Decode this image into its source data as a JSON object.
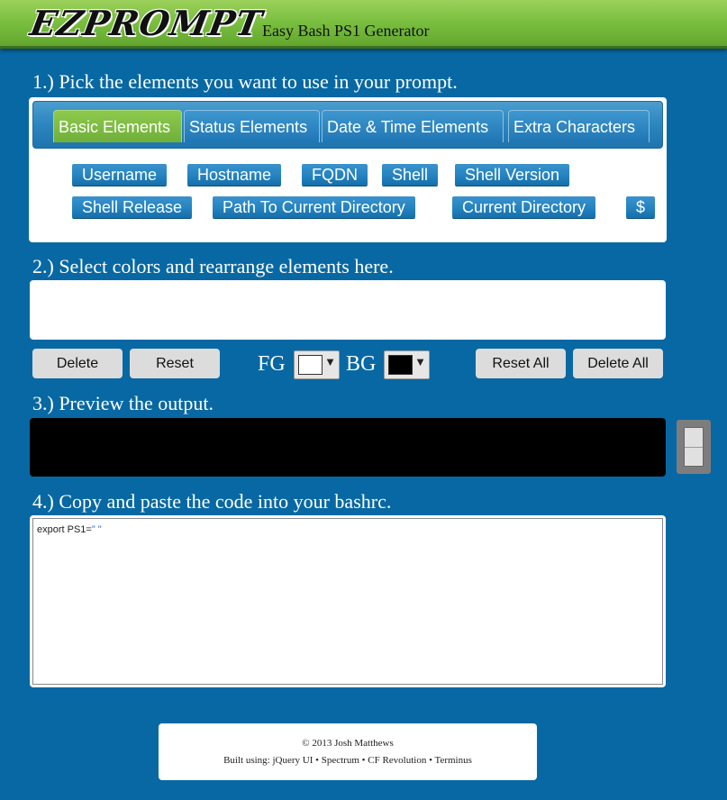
{
  "header": {
    "logo": "EZPROMPT",
    "tagline": "Easy Bash PS1 Generator"
  },
  "sections": {
    "pick": "1.) Pick the elements you want to use in your prompt.",
    "arrange": "2.) Select colors and rearrange elements here.",
    "preview": "3.) Preview the output.",
    "copy": "4.) Copy and paste the code into your bashrc."
  },
  "tabs": [
    {
      "label": "Basic Elements",
      "active": true
    },
    {
      "label": "Status Elements",
      "active": false
    },
    {
      "label": "Date & Time Elements",
      "active": false
    },
    {
      "label": "Extra Characters",
      "active": false
    }
  ],
  "elements": [
    "Username",
    "Hostname",
    "FQDN",
    "Shell",
    "Shell Version",
    "Shell Release",
    "Path To Current Directory",
    "Current Directory",
    "$"
  ],
  "controls": {
    "delete": "Delete",
    "reset": "Reset",
    "fg_label": "FG",
    "bg_label": "BG",
    "reset_all": "Reset All",
    "delete_all": "Delete All",
    "fg_color": "#ffffff",
    "bg_color": "#000000",
    "dropdown_arrow": "▼"
  },
  "code": {
    "prefix": "export PS1=",
    "value": "\" \""
  },
  "footer": {
    "copyright": "© 2013 Josh Matthews",
    "built_using": "Built using: jQuery UI • Spectrum • CF Revolution • Terminus"
  },
  "colors": {
    "page_bg": "#0868a3",
    "header_green": "#7cc041",
    "chip_blue": "#2483c1",
    "active_tab_green": "#6fb03a"
  }
}
